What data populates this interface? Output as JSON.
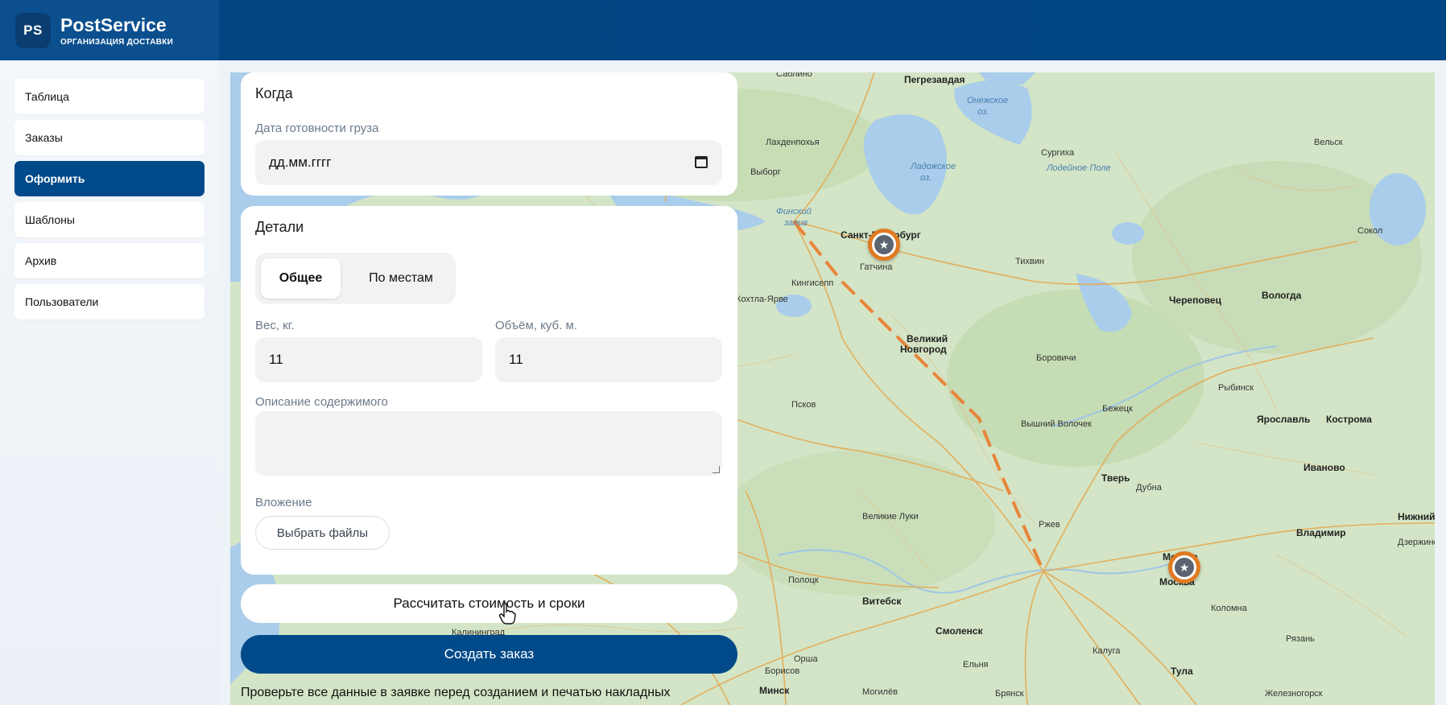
{
  "brand": {
    "logo": "PS",
    "name": "PostService",
    "subtitle": "ОРГАНИЗАЦИЯ ДОСТАВКИ"
  },
  "sidebar": {
    "items": [
      {
        "label": "Таблица",
        "active": false
      },
      {
        "label": "Заказы",
        "active": false
      },
      {
        "label": "Оформить",
        "active": true
      },
      {
        "label": "Шаблоны",
        "active": false
      },
      {
        "label": "Архив",
        "active": false
      },
      {
        "label": "Пользователи",
        "active": false
      }
    ]
  },
  "when": {
    "title": "Когда",
    "date_label": "Дата готовности груза",
    "date_value": "дд.мм.гггг",
    "date_icon": "calendar-icon"
  },
  "details": {
    "title": "Детали",
    "tabs": [
      {
        "label": "Общее",
        "active": true
      },
      {
        "label": "По местам",
        "active": false
      }
    ],
    "weight_label": "Вес, кг.",
    "weight_value": "11",
    "volume_label": "Объём, куб. м.",
    "volume_value": "11",
    "description_label": "Описание содержимого",
    "description_value": "",
    "attachment_label": "Вложение",
    "attachment_button": "Выбрать файлы"
  },
  "actions": {
    "calculate": "Рассчитать стоимость и сроки",
    "create": "Создать заказ",
    "note": "Проверьте все данные в заявке перед созданием и печатью накладных"
  },
  "map": {
    "route_color": "#e8853a",
    "marker_color": "#e07a22",
    "water_color": "#a9cdea",
    "labels": {
      "sablino": "Саблино",
      "pegrevskaya": "Пегрезавдая",
      "onega": "Онежское",
      "onega2": "оз.",
      "velsk": "Вельск",
      "lakhdenpokhya": "Лахденпохья",
      "lodeynoe": "Лодейное Поле",
      "vyborg": "Выборг",
      "ladoga1": "Ладожское",
      "ladoga2": "оз.",
      "finnish1": "Финский",
      "finnish2": "залив",
      "spb": "Санкт-Петербург",
      "tikhvin": "Тихвин",
      "gatchina": "Гатчина",
      "kingisepp": "Кингисепп",
      "narva": "Кохтла-Ярве",
      "cherepovets": "Череповец",
      "vologda": "Вологда",
      "sokol": "Сокол",
      "vnovgorod1": "Великий",
      "vnovgorod2": "Новгород",
      "borovichi": "Боровичи",
      "rybinsk": "Рыбинск",
      "pskov": "Псков",
      "bezhetsk": "Бежецк",
      "vvolochek": "Вышний Волочек",
      "yaroslavl": "Ярославль",
      "kostroma": "Кострома",
      "tver": "Тверь",
      "dubna": "Дубна",
      "ivanovo": "Иваново",
      "vluki": "Великие Луки",
      "rzhev": "Ржев",
      "vladimir": "Владимир",
      "nizhny": "Нижний",
      "dzerzh": "Дзержинск",
      "moscow1": "Москва",
      "moscow2": "Москва",
      "polotsk": "Полоцк",
      "vitebsk": "Витебск",
      "smolensk": "Смоленск",
      "kolomna": "Коломна",
      "ryazan": "Рязань",
      "kaluga": "Калуга",
      "orsha": "Орша",
      "tula": "Тула",
      "borisov": "Борисов",
      "minsk": "Минск",
      "mogilev": "Могилёв",
      "bryansk": "Брянск",
      "suoyarvi": "Сургиха",
      "zheleznogorsk": "Железногорск",
      "elek": "Ельня",
      "kaliningrad": "Калининград"
    }
  }
}
